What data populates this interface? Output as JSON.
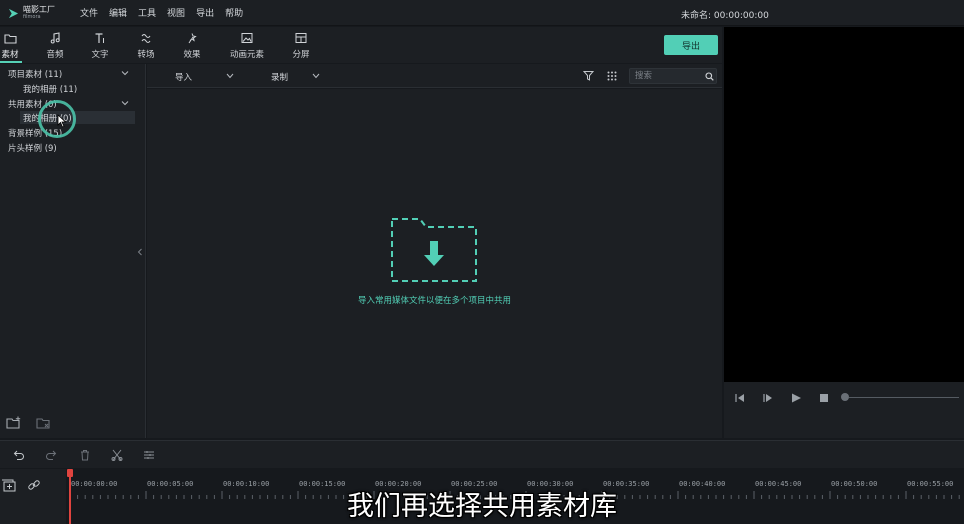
{
  "app": {
    "logo_cn": "喵影工厂",
    "logo_en": "filmora"
  },
  "menu": [
    "文件",
    "编辑",
    "工具",
    "视图",
    "导出",
    "帮助"
  ],
  "project": {
    "title": "未命名: 00:00:00:00"
  },
  "toolbar": {
    "tabs": [
      {
        "label": "素材",
        "icon": "folder-icon"
      },
      {
        "label": "音频",
        "icon": "music-note-icon"
      },
      {
        "label": "文字",
        "icon": "text-icon"
      },
      {
        "label": "转场",
        "icon": "transition-icon"
      },
      {
        "label": "效果",
        "icon": "effects-icon"
      },
      {
        "label": "动画元素",
        "icon": "image-icon"
      },
      {
        "label": "分屏",
        "icon": "split-screen-icon"
      }
    ],
    "export_label": "导出"
  },
  "library": {
    "items": [
      {
        "label": "项目素材 (11)"
      },
      {
        "label": "我的相册 (11)"
      },
      {
        "label": "共用素材 (0)"
      },
      {
        "label": "我的相册 (0)"
      },
      {
        "label": "背景样例 (15)"
      },
      {
        "label": "片头样例 (9)"
      }
    ]
  },
  "media": {
    "import_label": "导入",
    "record_label": "录制",
    "search_placeholder": "搜索",
    "empty_text": "导入常用媒体文件以便在多个项目中共用"
  },
  "timeline": {
    "ticks": [
      "00:00:00:00",
      "00:00:05:00",
      "00:00:10:00",
      "00:00:15:00",
      "00:00:20:00",
      "00:00:25:00",
      "00:00:30:00",
      "00:00:35:00",
      "00:00:40:00",
      "00:00:45:00",
      "00:00:50:00",
      "00:00:55:00"
    ]
  },
  "subtitle": "我们再选择共用素材库",
  "colors": {
    "accent": "#52cfb6",
    "playhead": "#e0443f"
  }
}
